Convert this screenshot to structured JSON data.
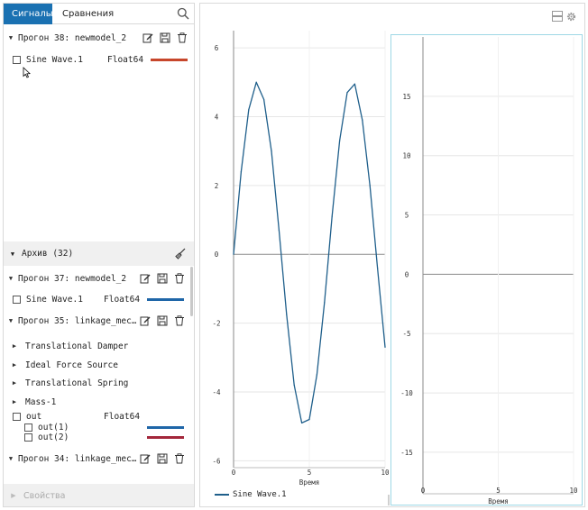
{
  "tabs": {
    "signals": "Сигналы",
    "compare": "Сравнения"
  },
  "runs": {
    "current": {
      "label": "Прогон 38: newmodel_2",
      "signal": {
        "name": "Sine Wave.1",
        "type": "Float64",
        "color": "#c7462b"
      }
    },
    "archive": {
      "label": "Архив (32)"
    },
    "run37": {
      "label": "Прогон 37: newmodel_2",
      "signal": {
        "name": "Sine Wave.1",
        "type": "Float64",
        "color": "#1f66a8"
      }
    },
    "run35": {
      "label": "Прогон 35: linkage_mec…",
      "children": [
        "Translational Damper",
        "Ideal Force Source",
        "Translational Spring",
        "Mass-1"
      ],
      "out": {
        "name": "out",
        "type": "Float64"
      },
      "out1": {
        "name": "out(1)",
        "color": "#1f66a8"
      },
      "out2": {
        "name": "out(2)",
        "color": "#a3273b"
      }
    },
    "run34": {
      "label": "Прогон 34: linkage_mec…"
    }
  },
  "properties": "Свойства",
  "plot1": {
    "y_ticks": [
      "6",
      "4",
      "2",
      "0",
      "-2",
      "-4",
      "-6"
    ],
    "x_ticks": [
      "0",
      "5",
      "10"
    ],
    "xlabel": "Время"
  },
  "plot2": {
    "y_ticks": [
      "15",
      "10",
      "5",
      "0",
      "-5",
      "-10",
      "-15"
    ],
    "x_ticks": [
      "0",
      "5",
      "10"
    ],
    "xlabel": "Время"
  },
  "legend": {
    "label": "Sine Wave.1",
    "color": "#1f5f8b"
  },
  "chart_data": [
    {
      "type": "line",
      "series": [
        {
          "name": "Sine Wave.1",
          "color": "#1f5f8b",
          "x": [
            0,
            0.5,
            1,
            1.5,
            2,
            2.5,
            3,
            3.5,
            4,
            4.5,
            5,
            5.5,
            6,
            6.5,
            7,
            7.5,
            8,
            8.5,
            9,
            9.5,
            10
          ],
          "y": [
            0,
            2.4,
            4.2,
            5.0,
            4.5,
            3.0,
            0.7,
            -1.75,
            -3.8,
            -4.9,
            -4.8,
            -3.5,
            -1.4,
            1.1,
            3.3,
            4.7,
            4.95,
            3.9,
            2.0,
            -0.4,
            -2.7
          ]
        }
      ],
      "xlabel": "Время",
      "ylabel": "",
      "xlim": [
        0,
        10
      ],
      "ylim": [
        -6.2,
        6.5
      ],
      "xticks": [
        0,
        5,
        10
      ],
      "yticks": [
        6,
        4,
        2,
        0,
        -2,
        -4,
        -6
      ],
      "grid": true
    },
    {
      "type": "line",
      "series": [],
      "xlabel": "Время",
      "ylabel": "",
      "xlim": [
        0,
        10
      ],
      "ylim": [
        -18.5,
        20
      ],
      "xticks": [
        0,
        5,
        10
      ],
      "yticks": [
        15,
        10,
        5,
        0,
        -5,
        -10,
        -15
      ],
      "grid": true
    }
  ]
}
